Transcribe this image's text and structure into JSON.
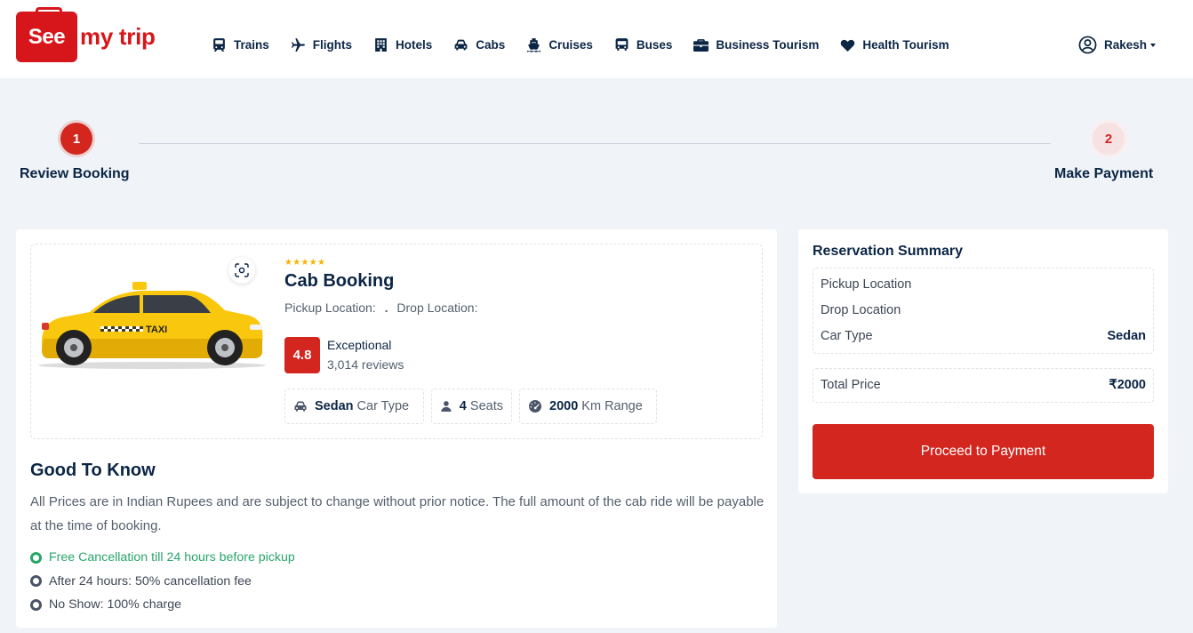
{
  "brand": {
    "logo_see": "See",
    "logo_rest": "my trip",
    "color": "#d7161b"
  },
  "nav": {
    "items": [
      {
        "label": "Trains",
        "icon": "train-icon"
      },
      {
        "label": "Flights",
        "icon": "plane-icon"
      },
      {
        "label": "Hotels",
        "icon": "hotel-icon"
      },
      {
        "label": "Cabs",
        "icon": "car-icon"
      },
      {
        "label": "Cruises",
        "icon": "ship-icon"
      },
      {
        "label": "Buses",
        "icon": "bus-icon"
      },
      {
        "label": "Business Tourism",
        "icon": "briefcase-icon"
      },
      {
        "label": "Health Tourism",
        "icon": "heart-pulse-icon"
      }
    ],
    "user": "Rakesh"
  },
  "stepper": {
    "steps": [
      {
        "number": "1",
        "label": "Review Booking",
        "active": true
      },
      {
        "number": "2",
        "label": "Make Payment",
        "active": false
      }
    ]
  },
  "booking": {
    "stars": "★★★★★",
    "title": "Cab Booking",
    "pickup_label": "Pickup Location:",
    "separator": ".",
    "drop_label": "Drop Location:",
    "rating": "4.8",
    "rating_word": "Exceptional",
    "reviews": "3,014 reviews",
    "features": [
      {
        "value": "Sedan",
        "unit": "Car Type",
        "icon": "car-icon"
      },
      {
        "value": "4",
        "unit": "Seats",
        "icon": "user-icon"
      },
      {
        "value": "2000",
        "unit": "Km Range",
        "icon": "gauge-icon"
      }
    ]
  },
  "good_to_know": {
    "title": "Good To Know",
    "text": "All Prices are in Indian Rupees and are subject to change without prior notice. The full amount of the cab ride will be payable at the time of booking.",
    "items": [
      {
        "label": "Free Cancellation till 24 hours before pickup",
        "highlight": true
      },
      {
        "label": "After 24 hours: 50% cancellation fee",
        "highlight": false
      },
      {
        "label": "No Show: 100% charge",
        "highlight": false
      }
    ]
  },
  "summary": {
    "title": "Reservation Summary",
    "rows": [
      {
        "label": "Pickup Location",
        "value": ""
      },
      {
        "label": "Drop Location",
        "value": ""
      },
      {
        "label": "Car Type",
        "value": "Sedan"
      }
    ],
    "total_label": "Total Price",
    "total_value": "₹2000",
    "button": "Proceed to Payment"
  },
  "colors": {
    "accent": "#d3261f",
    "navy": "#0b2545",
    "success": "#28a66a",
    "taxi": "#f9c80e"
  }
}
